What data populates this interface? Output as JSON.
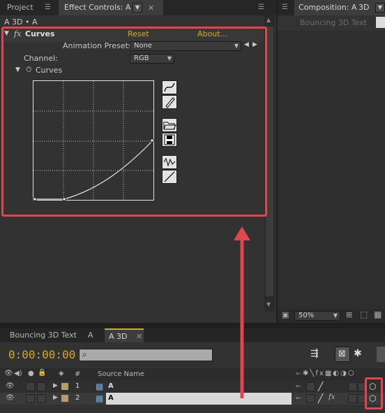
{
  "top_left_tabs": {
    "project": "Project",
    "effect_controls": "Effect Controls: A"
  },
  "breadcrumb": "A  3D • A",
  "effect": {
    "fx_symbol": "fx",
    "name": "Curves",
    "reset": "Reset",
    "about": "About...",
    "animation_presets_label": "Animation Presets:",
    "animation_presets_value": "None",
    "channel_label": "Channel:",
    "channel_value": "RGB",
    "curves_label": "Curves"
  },
  "composition": {
    "tab": "Composition: A",
    "tab_suffix": "3D",
    "placeholder_label": "Bouncing 3D Text",
    "zoom": "50%"
  },
  "timeline": {
    "tabs": [
      "Bouncing 3D Text",
      "A",
      "A  3D"
    ],
    "timecode": "0:00:00:00",
    "search_placeholder": "",
    "col_hash": "#",
    "col_source": "Source Name",
    "layers": [
      {
        "num": "1",
        "name": "A"
      },
      {
        "num": "2",
        "name": "A"
      }
    ]
  },
  "colors": {
    "accent_orange": "#d7a72a",
    "annotation_red": "#e0474c",
    "label_swatch": "#b49c6b"
  }
}
